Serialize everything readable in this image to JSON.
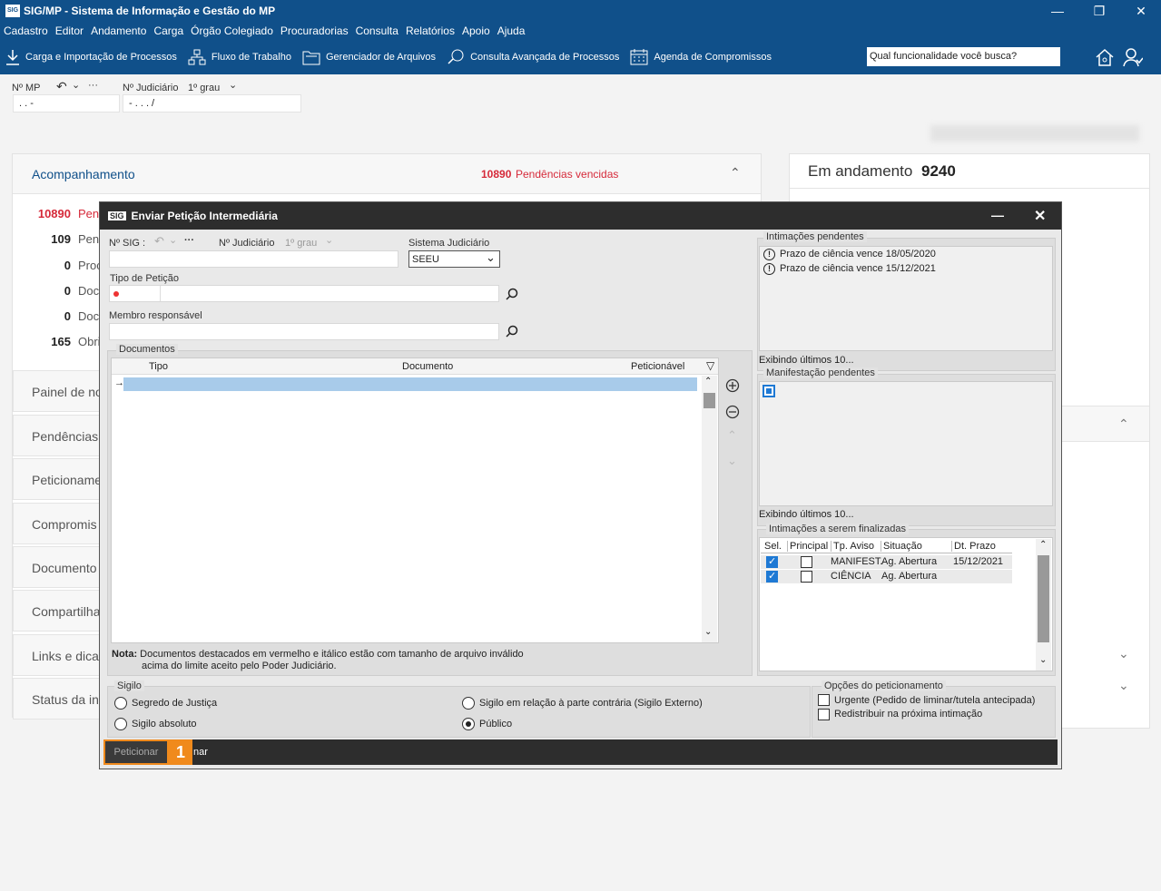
{
  "window": {
    "title": "SIG/MP - Sistema de Informação e Gestão do MP",
    "logo_text": "SIG"
  },
  "menu": [
    "Cadastro",
    "Editor",
    "Andamento",
    "Carga",
    "Órgão Colegiado",
    "Procuradorias",
    "Consulta",
    "Relatórios",
    "Apoio",
    "Ajuda"
  ],
  "toolbar": {
    "items": [
      {
        "label": "Carga e Importação de Processos",
        "icon": "download-icon"
      },
      {
        "label": "Fluxo de Trabalho",
        "icon": "workflow-icon"
      },
      {
        "label": "Gerenciador de Arquivos",
        "icon": "folder-icon"
      },
      {
        "label": "Consulta Avançada de Processos",
        "icon": "search-doc-icon"
      },
      {
        "label": "Agenda de Compromissos",
        "icon": "calendar-icon"
      }
    ],
    "search_placeholder": "Qual funcionalidade você busca?"
  },
  "header_fields": {
    "mp_label": "Nº MP",
    "mp_value": ".  .    -",
    "judiciario_label": "Nº Judiciário",
    "grau_label": "1º grau",
    "judiciario_value": "-  .  .  .   /",
    "more_dots": "···"
  },
  "acompanhamento": {
    "title": "Acompanhamento",
    "vencidas_count": "10890",
    "vencidas_label": "Pendências vencidas",
    "stats": [
      {
        "num": "10890",
        "label": "Pend",
        "red": true
      },
      {
        "num": "109",
        "label": "Pend",
        "red": false
      },
      {
        "num": "0",
        "label": "Proc",
        "red": false
      },
      {
        "num": "0",
        "label": "Doc",
        "red": false
      },
      {
        "num": "0",
        "label": "Doc",
        "red": false
      },
      {
        "num": "165",
        "label": "Obri",
        "red": false
      }
    ]
  },
  "sections": [
    "Painel de no",
    "Pendências",
    "Peticioname",
    "Compromis",
    "Documento",
    "Compartilha",
    "Links e dica",
    "Status da in"
  ],
  "em_andamento": {
    "label": "Em andamento",
    "count": "9240"
  },
  "dialog": {
    "title": "Enviar Petição Intermediária",
    "sig_label": "Nº SIG :",
    "dots": "···",
    "judiciario_label": "Nº Judiciário",
    "grau_label": "1º grau",
    "sistema_label": "Sistema Judiciário",
    "sistema_value": "SEEU",
    "tipo_label": "Tipo de Petição",
    "membro_label": "Membro responsável",
    "documentos": {
      "title": "Documentos",
      "columns": [
        "Tipo",
        "Documento",
        "Peticionável"
      ]
    },
    "nota_label": "Nota:",
    "nota_text_1": "Documentos destacados em vermelho e itálico estão com tamanho de arquivo inválido",
    "nota_text_2": "acima do limite aceito pelo Poder Judiciário.",
    "intimacoes_pendentes": {
      "title": "Intimações pendentes",
      "items": [
        "Prazo de ciência vence 18/05/2020",
        "Prazo de ciência vence 15/12/2021"
      ],
      "footer": "Exibindo últimos 10..."
    },
    "manifestacao": {
      "title": "Manifestação pendentes",
      "footer": "Exibindo últimos 10..."
    },
    "finalizadas": {
      "title": "Intimações a serem finalizadas",
      "columns": [
        "Sel.",
        "Principal",
        "Tp. Aviso",
        "Situação",
        "Dt. Prazo"
      ],
      "rows": [
        {
          "tp": "MANIFEST.",
          "situacao": "Ag. Abertura",
          "prazo": "15/12/2021"
        },
        {
          "tp": "CIÊNCIA",
          "situacao": "Ag. Abertura",
          "prazo": ""
        }
      ]
    },
    "sigilo": {
      "title": "Sigilo",
      "options": [
        "Segredo de Justiça",
        "Sigilo em relação à parte contrária (Sigilo Externo)",
        "Sigilo absoluto",
        "Público"
      ]
    },
    "opcoes": {
      "title": "Opções do peticionamento",
      "items": [
        "Urgente (Pedido de liminar/tutela antecipada)",
        "Redistribuir na próxima intimação"
      ]
    },
    "peticionar_label": "Peticionar",
    "cancelar_partial": "nar",
    "step_badge": "1"
  },
  "colors": {
    "brand": "#10508a",
    "accent_red": "#d62a3a",
    "highlight": "#f08a1c",
    "selection": "#a8cbea"
  }
}
